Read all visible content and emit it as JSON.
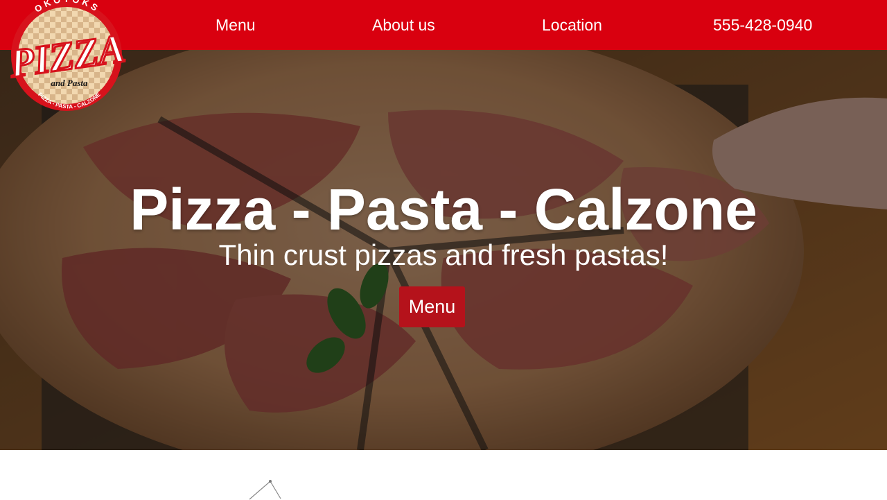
{
  "brand": {
    "logo_top_text": "OKOTOKS",
    "logo_main_text": "PIZZA",
    "logo_sub_text": "and Pasta",
    "logo_bottom_text": "PIZZA - PASTA - CALZONE",
    "primary_color": "#d9000f",
    "button_color": "#b5121b"
  },
  "nav": {
    "items": [
      {
        "label": "Menu"
      },
      {
        "label": "About us"
      },
      {
        "label": "Location"
      },
      {
        "label": "555-428-0940"
      }
    ]
  },
  "hero": {
    "title": "Pizza - Pasta - Calzone",
    "subtitle": "Thin crust pizzas and fresh pastas!",
    "button_label": "Menu"
  }
}
